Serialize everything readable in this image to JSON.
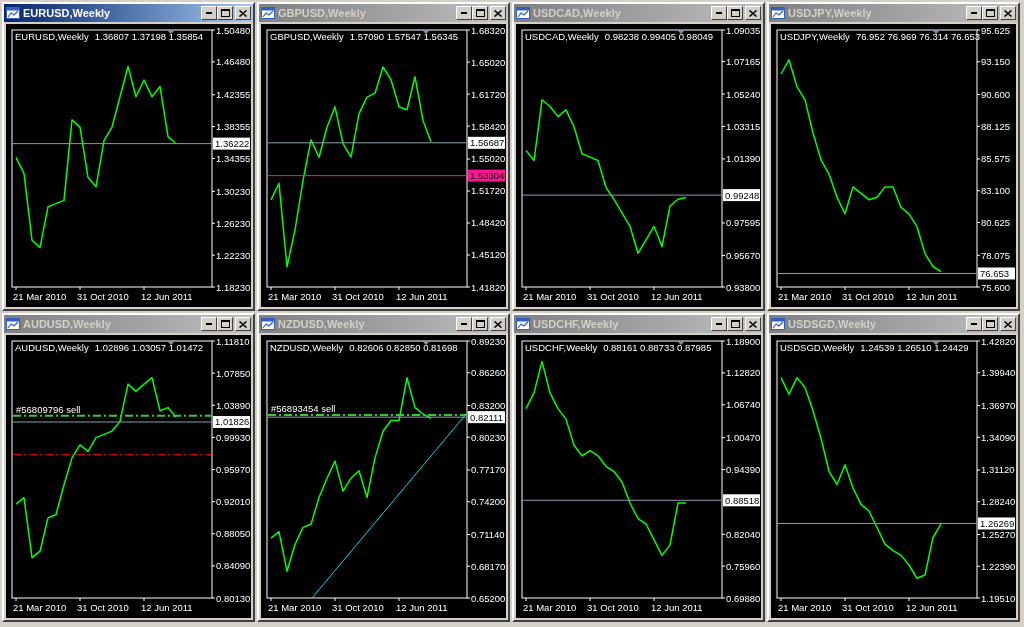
{
  "windows": [
    {
      "title": "EURUSD,Weekly",
      "active": true,
      "chart_label": "EURUSD,Weekly",
      "quote": "1.36807 1.37198 1.35854",
      "time_labels": [
        "21 Mar 2010",
        "31 Oct 2010",
        "12 Jun 2011"
      ],
      "chart_data": {
        "type": "line",
        "categories": [
          null,
          null,
          null,
          null,
          null,
          null,
          null,
          null,
          null,
          null,
          null,
          null,
          null,
          null,
          null,
          null,
          null,
          null,
          null,
          null,
          null
        ],
        "series": [
          {
            "color": "#00ff00",
            "values": [
              1.345,
              1.325,
              1.241,
              1.232,
              1.283,
              1.287,
              1.291,
              1.392,
              1.383,
              1.32,
              1.308,
              1.366,
              1.383,
              1.421,
              1.459,
              1.421,
              1.442,
              1.421,
              1.434,
              1.371,
              1.362
            ]
          }
        ],
        "ylim": [
          1.1823,
          1.5048
        ],
        "yticks": [
          {
            "value": 1.5048,
            "label": "1.50480"
          },
          {
            "value": 1.4648,
            "label": "1.46480"
          },
          {
            "value": 1.42355,
            "label": "1.42355"
          },
          {
            "value": 1.38355,
            "label": "1.38355"
          },
          {
            "value": 1.34355,
            "label": "1.34355"
          },
          {
            "value": 1.3023,
            "label": "1.30230"
          },
          {
            "value": 1.2623,
            "label": "1.26230"
          },
          {
            "value": 1.2223,
            "label": "1.22230"
          },
          {
            "value": 1.1823,
            "label": "1.18230"
          }
        ],
        "ref_lines": [
          {
            "axis": "y",
            "value": 1.36222,
            "label": "1.36222",
            "color": "#8c9cac"
          }
        ]
      }
    },
    {
      "title": "GBPUSD,Weekly",
      "active": false,
      "chart_label": "GBPUSD,Weekly",
      "quote": "1.57090 1.57547 1.56345",
      "time_labels": [
        "21 Mar 2010",
        "31 Oct 2010",
        "12 Jun 2011"
      ],
      "chart_data": {
        "type": "line",
        "categories": [
          null,
          null,
          null,
          null,
          null,
          null,
          null,
          null,
          null,
          null,
          null,
          null,
          null,
          null,
          null,
          null,
          null,
          null,
          null,
          null,
          null
        ],
        "series": [
          {
            "color": "#00ff00",
            "values": [
              1.508,
              1.525,
              1.439,
              1.477,
              1.528,
              1.57,
              1.552,
              1.583,
              1.604,
              1.566,
              1.552,
              1.597,
              1.614,
              1.618,
              1.645,
              1.632,
              1.604,
              1.601,
              1.635,
              1.59,
              1.568
            ]
          }
        ],
        "ylim": [
          1.4182,
          1.6832
        ],
        "yticks": [
          {
            "value": 1.6832,
            "label": "1.68320"
          },
          {
            "value": 1.6502,
            "label": "1.65020"
          },
          {
            "value": 1.6172,
            "label": "1.61720"
          },
          {
            "value": 1.5842,
            "label": "1.58420"
          },
          {
            "value": 1.5502,
            "label": "1.55020"
          },
          {
            "value": 1.5172,
            "label": "1.51720"
          },
          {
            "value": 1.4842,
            "label": "1.48420"
          },
          {
            "value": 1.4512,
            "label": "1.45120"
          },
          {
            "value": 1.4182,
            "label": "1.41820"
          }
        ],
        "ref_lines": [
          {
            "axis": "y",
            "value": 1.56687,
            "label": "1.56687",
            "color": "#8c9cac"
          },
          {
            "axis": "y",
            "value": 1.53304,
            "label": "1.53304",
            "color": "#ff1493"
          }
        ]
      }
    },
    {
      "title": "USDCAD,Weekly",
      "active": false,
      "chart_label": "USDCAD,Weekly",
      "quote": "0.98238 0.99405 0.98049",
      "time_labels": [
        "21 Mar 2010",
        "31 Oct 2010",
        "12 Jun 2011"
      ],
      "chart_data": {
        "type": "line",
        "categories": [
          null,
          null,
          null,
          null,
          null,
          null,
          null,
          null,
          null,
          null,
          null,
          null,
          null,
          null,
          null,
          null,
          null,
          null,
          null,
          null,
          null
        ],
        "series": [
          {
            "color": "#00ff00",
            "values": [
              1.019,
              1.013,
              1.049,
              1.045,
              1.039,
              1.043,
              1.033,
              1.017,
              1.015,
              1.013,
              0.997,
              0.99,
              0.982,
              0.974,
              0.958,
              0.966,
              0.974,
              0.962,
              0.986,
              0.99,
              0.991
            ]
          }
        ],
        "ylim": [
          0.938,
          1.09035
        ],
        "yticks": [
          {
            "value": 1.09035,
            "label": "1.09035"
          },
          {
            "value": 1.07165,
            "label": "1.07165"
          },
          {
            "value": 1.0524,
            "label": "1.05240"
          },
          {
            "value": 1.03315,
            "label": "1.03315"
          },
          {
            "value": 1.0139,
            "label": "1.01390"
          },
          {
            "value": 0.97595,
            "label": "0.97595"
          },
          {
            "value": 0.9567,
            "label": "0.95670"
          },
          {
            "value": 0.938,
            "label": "0.93800"
          }
        ],
        "ref_lines": [
          {
            "axis": "y",
            "value": 0.99248,
            "label": "0.99248",
            "color": "#8c9cac"
          }
        ]
      }
    },
    {
      "title": "USDJPY,Weekly",
      "active": false,
      "chart_label": "USDJPY,Weekly",
      "quote": "76.952 76.969 76.314 76.653",
      "time_labels": [
        "21 Mar 2010",
        "31 Oct 2010",
        "12 Jun 2011"
      ],
      "chart_data": {
        "type": "line",
        "categories": [
          null,
          null,
          null,
          null,
          null,
          null,
          null,
          null,
          null,
          null,
          null,
          null,
          null,
          null,
          null,
          null,
          null,
          null,
          null,
          null,
          null
        ],
        "series": [
          {
            "color": "#00ff00",
            "values": [
              92.2,
              93.3,
              91.2,
              90.2,
              87.6,
              85.5,
              84.4,
              82.6,
              81.3,
              83.4,
              82.9,
              82.4,
              82.6,
              83.4,
              83.4,
              81.8,
              81.3,
              80.3,
              78.2,
              77.2,
              76.8
            ]
          }
        ],
        "ylim": [
          75.6,
          95.625
        ],
        "yticks": [
          {
            "value": 95.625,
            "label": "95.625"
          },
          {
            "value": 93.15,
            "label": "93.150"
          },
          {
            "value": 90.6,
            "label": "90.600"
          },
          {
            "value": 88.125,
            "label": "88.125"
          },
          {
            "value": 85.575,
            "label": "85.575"
          },
          {
            "value": 83.1,
            "label": "83.100"
          },
          {
            "value": 80.625,
            "label": "80.625"
          },
          {
            "value": 78.075,
            "label": "78.075"
          },
          {
            "value": 75.6,
            "label": "75.600"
          }
        ],
        "ref_lines": [
          {
            "axis": "y",
            "value": 76.653,
            "label": "76.653",
            "color": "#8c9cac"
          }
        ]
      }
    },
    {
      "title": "AUDUSD,Weekly",
      "active": false,
      "chart_label": "AUDUSD,Weekly",
      "quote": "1.02896 1.03057 1.01472",
      "time_labels": [
        "21 Mar 2010",
        "31 Oct 2010",
        "12 Jun 2011"
      ],
      "chart_data": {
        "type": "line",
        "categories": [
          null,
          null,
          null,
          null,
          null,
          null,
          null,
          null,
          null,
          null,
          null,
          null,
          null,
          null,
          null,
          null,
          null,
          null,
          null,
          null,
          null
        ],
        "series": [
          {
            "color": "#00ff00",
            "values": [
              0.917,
              0.925,
              0.851,
              0.859,
              0.9,
              0.904,
              0.941,
              0.974,
              0.99,
              0.982,
              0.999,
              1.003,
              1.007,
              1.019,
              1.065,
              1.056,
              1.065,
              1.073,
              1.032,
              1.036,
              1.024
            ]
          }
        ],
        "ylim": [
          0.8013,
          1.1181
        ],
        "yticks": [
          {
            "value": 1.1181,
            "label": "1.11810"
          },
          {
            "value": 1.0785,
            "label": "1.07850"
          },
          {
            "value": 1.0389,
            "label": "1.03890"
          },
          {
            "value": 0.9993,
            "label": "0.99930"
          },
          {
            "value": 0.9597,
            "label": "0.95970"
          },
          {
            "value": 0.9201,
            "label": "0.92010"
          },
          {
            "value": 0.8805,
            "label": "0.88050"
          },
          {
            "value": 0.8409,
            "label": "0.84090"
          },
          {
            "value": 0.8013,
            "label": "0.80130"
          }
        ],
        "ref_lines": [
          {
            "axis": "y",
            "value": 1.026,
            "label": "#56809796 sell",
            "color": "#32cd32"
          },
          {
            "axis": "y",
            "value": 0.978,
            "color": "#ff0000"
          },
          {
            "axis": "y",
            "value": 1.01826,
            "label": "1.01826",
            "color": "#8c9cac"
          }
        ]
      }
    },
    {
      "title": "NZDUSD,Weekly",
      "active": false,
      "chart_label": "NZDUSD,Weekly",
      "quote": "0.82606 0.82850 0.81698",
      "time_labels": [
        "21 Mar 2010",
        "31 Oct 2010",
        "12 Jun 2011"
      ],
      "trend_line": true,
      "chart_data": {
        "type": "line",
        "categories": [
          null,
          null,
          null,
          null,
          null,
          null,
          null,
          null,
          null,
          null,
          null,
          null,
          null,
          null,
          null,
          null,
          null,
          null,
          null,
          null,
          null
        ],
        "series": [
          {
            "color": "#00ff00",
            "values": [
              0.708,
              0.714,
              0.677,
              0.702,
              0.718,
              0.721,
              0.746,
              0.764,
              0.78,
              0.752,
              0.764,
              0.771,
              0.746,
              0.783,
              0.808,
              0.818,
              0.818,
              0.858,
              0.83,
              0.824,
              0.82
            ]
          }
        ],
        "ylim": [
          0.652,
          0.8923
        ],
        "yticks": [
          {
            "value": 0.8923,
            "label": "0.89230"
          },
          {
            "value": 0.8626,
            "label": "0.86260"
          },
          {
            "value": 0.832,
            "label": "0.83200"
          },
          {
            "value": 0.8023,
            "label": "0.80230"
          },
          {
            "value": 0.7717,
            "label": "0.77170"
          },
          {
            "value": 0.742,
            "label": "0.74200"
          },
          {
            "value": 0.7114,
            "label": "0.71140"
          },
          {
            "value": 0.6817,
            "label": "0.68170"
          },
          {
            "value": 0.652,
            "label": "0.65200"
          }
        ],
        "ref_lines": [
          {
            "axis": "y",
            "value": 0.823,
            "label": "#56893454 sell",
            "color": "#32cd32"
          },
          {
            "axis": "y",
            "value": 0.82111,
            "label": "0.82111",
            "color": "#8c9cac"
          }
        ]
      }
    },
    {
      "title": "USDCHF,Weekly",
      "active": false,
      "chart_label": "USDCHF,Weekly",
      "quote": "0.88161 0.88733 0.87985",
      "time_labels": [
        "21 Mar 2010",
        "31 Oct 2010",
        "12 Jun 2011"
      ],
      "chart_data": {
        "type": "line",
        "categories": [
          null,
          null,
          null,
          null,
          null,
          null,
          null,
          null,
          null,
          null,
          null,
          null,
          null,
          null,
          null,
          null,
          null,
          null,
          null,
          null,
          null
        ],
        "series": [
          {
            "color": "#00ff00",
            "values": [
              1.06,
              1.09,
              1.15,
              1.09,
              1.06,
              1.04,
              0.99,
              0.97,
              0.98,
              0.97,
              0.95,
              0.94,
              0.92,
              0.88,
              0.85,
              0.84,
              0.81,
              0.78,
              0.8,
              0.88,
              0.88
            ]
          }
        ],
        "ylim": [
          0.6988,
          1.189
        ],
        "yticks": [
          {
            "value": 1.189,
            "label": "1.18900"
          },
          {
            "value": 1.1282,
            "label": "1.12820"
          },
          {
            "value": 1.0674,
            "label": "1.06740"
          },
          {
            "value": 1.0047,
            "label": "1.00470"
          },
          {
            "value": 0.9439,
            "label": "0.94390"
          },
          {
            "value": 0.8204,
            "label": "0.82040"
          },
          {
            "value": 0.7596,
            "label": "0.75960"
          },
          {
            "value": 0.6988,
            "label": "0.69880"
          }
        ],
        "ref_lines": [
          {
            "axis": "y",
            "value": 0.88518,
            "label": "0.88518",
            "color": "#8c9cac"
          }
        ]
      }
    },
    {
      "title": "USDSGD,Weekly",
      "active": false,
      "chart_label": "USDSGD,Weekly",
      "quote": "1.24539 1.26510 1.24429",
      "time_labels": [
        "21 Mar 2010",
        "31 Oct 2010",
        "12 Jun 2011"
      ],
      "chart_data": {
        "type": "line",
        "categories": [
          null,
          null,
          null,
          null,
          null,
          null,
          null,
          null,
          null,
          null,
          null,
          null,
          null,
          null,
          null,
          null,
          null,
          null,
          null,
          null,
          null
        ],
        "series": [
          {
            "color": "#00ff00",
            "values": [
              1.395,
              1.38,
              1.395,
              1.386,
              1.365,
              1.34,
              1.31,
              1.298,
              1.316,
              1.295,
              1.28,
              1.274,
              1.259,
              1.244,
              1.238,
              1.234,
              1.225,
              1.213,
              1.216,
              1.25,
              1.262
            ]
          }
        ],
        "ylim": [
          1.1951,
          1.4282
        ],
        "yticks": [
          {
            "value": 1.4282,
            "label": "1.42820"
          },
          {
            "value": 1.3994,
            "label": "1.39940"
          },
          {
            "value": 1.3697,
            "label": "1.36970"
          },
          {
            "value": 1.3409,
            "label": "1.34090"
          },
          {
            "value": 1.3112,
            "label": "1.31120"
          },
          {
            "value": 1.2824,
            "label": "1.28240"
          },
          {
            "value": 1.2527,
            "label": "1.25270"
          },
          {
            "value": 1.2239,
            "label": "1.22390"
          },
          {
            "value": 1.1951,
            "label": "1.19510"
          }
        ],
        "ref_lines": [
          {
            "axis": "y",
            "value": 1.26269,
            "label": "1.26269",
            "color": "#8c9cac"
          }
        ]
      }
    }
  ]
}
